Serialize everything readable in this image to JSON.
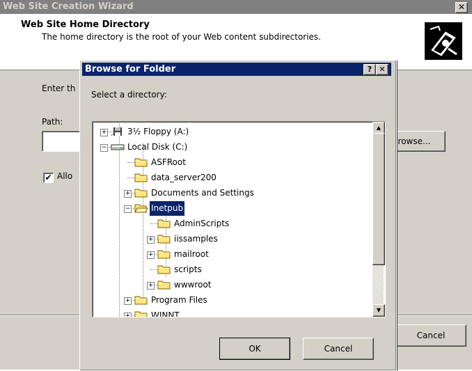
{
  "wizard": {
    "title": "Web Site Creation Wizard",
    "close_glyph": "✕",
    "header_title": "Web Site Home Directory",
    "header_subtitle": "The home directory is the root of your Web content subdirectories.",
    "enter_label": "Enter th",
    "path_label": "Path:",
    "path_value": "",
    "browse_label": "rowse...",
    "allow_checked_glyph": "✔",
    "allow_label": "Allo",
    "cancel_label": "Cancel"
  },
  "browse": {
    "title": "Browse for Folder",
    "help_glyph": "?",
    "close_glyph": "✕",
    "select_label": "Select a directory:",
    "scroll_up_glyph": "▲",
    "scroll_down_glyph": "▼",
    "ok_label": "OK",
    "cancel_label": "Cancel"
  },
  "tree": {
    "items": [
      {
        "label": "3½ Floppy (A:)",
        "icon": "floppy-icon",
        "expander": "+"
      },
      {
        "label": "Local Disk (C:)",
        "icon": "disk-icon",
        "expander": "−"
      },
      {
        "label": "ASFRoot",
        "icon": "folder-icon",
        "expander": ""
      },
      {
        "label": "data_server200",
        "icon": "folder-icon",
        "expander": ""
      },
      {
        "label": "Documents and Settings",
        "icon": "folder-icon",
        "expander": "+"
      },
      {
        "label": "Inetpub",
        "icon": "open-folder-icon",
        "expander": "−",
        "selected": true
      },
      {
        "label": "AdminScripts",
        "icon": "folder-icon",
        "expander": ""
      },
      {
        "label": "iissamples",
        "icon": "folder-icon",
        "expander": "+"
      },
      {
        "label": "mailroot",
        "icon": "folder-icon",
        "expander": "+"
      },
      {
        "label": "scripts",
        "icon": "folder-icon",
        "expander": ""
      },
      {
        "label": "wwwroot",
        "icon": "folder-icon",
        "expander": "+"
      },
      {
        "label": "Program Files",
        "icon": "folder-icon",
        "expander": "+"
      },
      {
        "label": "WINNT",
        "icon": "folder-icon",
        "expander": "+"
      }
    ]
  },
  "colors": {
    "dialog_face": "#d4d0c8",
    "active_title": "#0a246a",
    "inactive_title": "#808080",
    "folder_yellow": "#ffe680"
  }
}
